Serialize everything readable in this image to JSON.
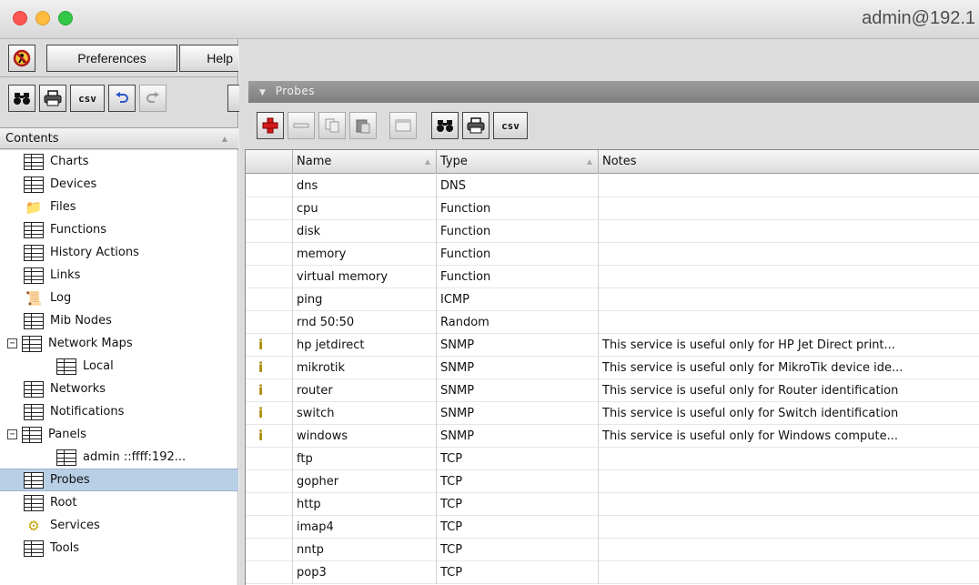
{
  "window": {
    "title": "admin@192.1"
  },
  "menubar": {
    "preferences": "Preferences",
    "help": "Help"
  },
  "left_toolbar": {
    "csv_label": "csv"
  },
  "contents": {
    "header": "Contents",
    "items": [
      {
        "label": "Charts",
        "icon": "table-icon"
      },
      {
        "label": "Devices",
        "icon": "table-icon"
      },
      {
        "label": "Files",
        "icon": "folder-icon"
      },
      {
        "label": "Functions",
        "icon": "table-icon"
      },
      {
        "label": "History Actions",
        "icon": "table-icon"
      },
      {
        "label": "Links",
        "icon": "table-icon"
      },
      {
        "label": "Log",
        "icon": "log-icon"
      },
      {
        "label": "Mib Nodes",
        "icon": "table-icon"
      },
      {
        "label": "Network Maps",
        "icon": "table-icon",
        "expander": "⊟"
      },
      {
        "label": "Local",
        "icon": "table-icon"
      },
      {
        "label": "Networks",
        "icon": "table-icon"
      },
      {
        "label": "Notifications",
        "icon": "table-icon"
      },
      {
        "label": "Panels",
        "icon": "table-icon",
        "expander": "⊟"
      },
      {
        "label": "admin ::ffff:192...",
        "icon": "table-icon"
      },
      {
        "label": "Probes",
        "icon": "table-icon",
        "selected": true
      },
      {
        "label": "Root",
        "icon": "table-icon"
      },
      {
        "label": "Services",
        "icon": "services-icon"
      },
      {
        "label": "Tools",
        "icon": "table-icon"
      }
    ]
  },
  "probes": {
    "section_title": "Probes",
    "toolbar": {
      "csv_label": "csv"
    },
    "columns": {
      "name": "Name",
      "type": "Type",
      "notes": "Notes"
    },
    "rows": [
      {
        "name": "dns",
        "type": "DNS",
        "notes": "",
        "info": false
      },
      {
        "name": "cpu",
        "type": "Function",
        "notes": "",
        "info": false
      },
      {
        "name": "disk",
        "type": "Function",
        "notes": "",
        "info": false
      },
      {
        "name": "memory",
        "type": "Function",
        "notes": "",
        "info": false
      },
      {
        "name": "virtual memory",
        "type": "Function",
        "notes": "",
        "info": false
      },
      {
        "name": "ping",
        "type": "ICMP",
        "notes": "",
        "info": false
      },
      {
        "name": "rnd 50:50",
        "type": "Random",
        "notes": "",
        "info": false
      },
      {
        "name": "hp jetdirect",
        "type": "SNMP",
        "notes": "This service is useful only for HP Jet Direct print...",
        "info": true
      },
      {
        "name": "mikrotik",
        "type": "SNMP",
        "notes": "This service is useful only for MikroTik device ide...",
        "info": true
      },
      {
        "name": "router",
        "type": "SNMP",
        "notes": "This service is useful only for Router identification",
        "info": true
      },
      {
        "name": "switch",
        "type": "SNMP",
        "notes": "This service is useful only for Switch identification",
        "info": true
      },
      {
        "name": "windows",
        "type": "SNMP",
        "notes": "This service is useful only for Windows compute...",
        "info": true
      },
      {
        "name": "ftp",
        "type": "TCP",
        "notes": "",
        "info": false
      },
      {
        "name": "gopher",
        "type": "TCP",
        "notes": "",
        "info": false
      },
      {
        "name": "http",
        "type": "TCP",
        "notes": "",
        "info": false
      },
      {
        "name": "imap4",
        "type": "TCP",
        "notes": "",
        "info": false
      },
      {
        "name": "nntp",
        "type": "TCP",
        "notes": "",
        "info": false
      },
      {
        "name": "pop3",
        "type": "TCP",
        "notes": "",
        "info": false
      }
    ]
  }
}
